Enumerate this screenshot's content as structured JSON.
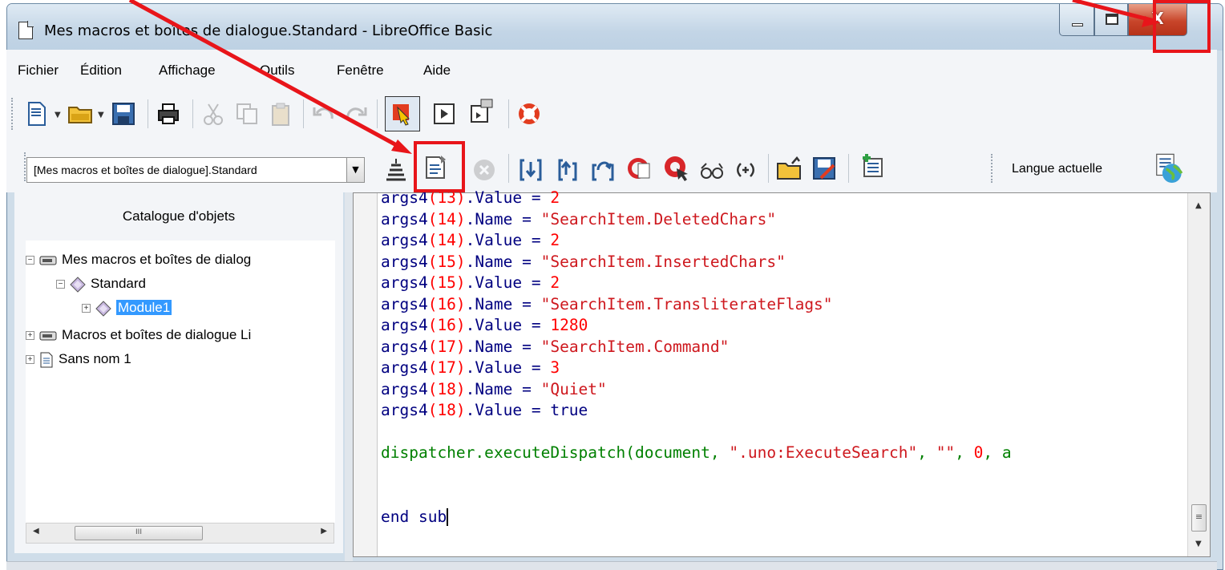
{
  "window": {
    "title": "Mes macros et boîtes de dialogue.Standard - LibreOffice Basic",
    "close_glyph": "X"
  },
  "menu": [
    "Fichier",
    "Édition",
    "Affichage",
    "Outils",
    "Fenêtre",
    "Aide"
  ],
  "toolbar1": {
    "icons": [
      "new-document-icon",
      "open-folder-icon",
      "save-icon",
      "print-icon",
      "cut-icon",
      "copy-icon",
      "paste-icon",
      "undo-icon",
      "redo-icon",
      "choose-macro-icon",
      "run-icon",
      "dialog-control-icon",
      "help-lifebuoy-icon"
    ]
  },
  "toolbar2": {
    "library_select": "[Mes macros et boîtes de dialogue].Standard",
    "language_label": "Langue actuelle",
    "icons": [
      "compile-icon",
      "run-basic-icon",
      "stop-icon",
      "step-into-icon",
      "step-out-icon",
      "step-over-icon",
      "breakpoint-icon",
      "manage-breakpoints-icon",
      "watch-glasses-icon",
      "find-parentheses-icon",
      "import-basic-icon",
      "export-basic-icon",
      "object-catalog-icon",
      "language-icon"
    ]
  },
  "catalog": {
    "title": "Catalogue d'objets",
    "tree": [
      {
        "label": "Mes macros et boîtes de dialog",
        "expander": "−",
        "level": 0,
        "icon": "drive-icon"
      },
      {
        "label": "Standard",
        "expander": "−",
        "level": 1,
        "icon": "library-diamond-icon"
      },
      {
        "label": "Module1",
        "expander": "+",
        "level": 2,
        "icon": "module-diamond-icon",
        "selected": true
      },
      {
        "label": "Macros et boîtes de dialogue Li",
        "expander": "+",
        "level": 0,
        "icon": "drive-icon"
      },
      {
        "label": "Sans nom 1",
        "expander": "+",
        "level": 0,
        "icon": "document-icon"
      }
    ],
    "hscroll_grip": "III"
  },
  "editor": {
    "lines": [
      [
        {
          "t": "args4",
          "c": "id"
        },
        {
          "t": "(13)",
          "c": "num"
        },
        {
          "t": ".Value = ",
          "c": "id"
        },
        {
          "t": "2",
          "c": "num"
        }
      ],
      [
        {
          "t": "args4",
          "c": "id"
        },
        {
          "t": "(14)",
          "c": "num"
        },
        {
          "t": ".Name = ",
          "c": "id"
        },
        {
          "t": "\"SearchItem.DeletedChars\"",
          "c": "str"
        }
      ],
      [
        {
          "t": "args4",
          "c": "id"
        },
        {
          "t": "(14)",
          "c": "num"
        },
        {
          "t": ".Value = ",
          "c": "id"
        },
        {
          "t": "2",
          "c": "num"
        }
      ],
      [
        {
          "t": "args4",
          "c": "id"
        },
        {
          "t": "(15)",
          "c": "num"
        },
        {
          "t": ".Name = ",
          "c": "id"
        },
        {
          "t": "\"SearchItem.InsertedChars\"",
          "c": "str"
        }
      ],
      [
        {
          "t": "args4",
          "c": "id"
        },
        {
          "t": "(15)",
          "c": "num"
        },
        {
          "t": ".Value = ",
          "c": "id"
        },
        {
          "t": "2",
          "c": "num"
        }
      ],
      [
        {
          "t": "args4",
          "c": "id"
        },
        {
          "t": "(16)",
          "c": "num"
        },
        {
          "t": ".Name = ",
          "c": "id"
        },
        {
          "t": "\"SearchItem.TransliterateFlags\"",
          "c": "str"
        }
      ],
      [
        {
          "t": "args4",
          "c": "id"
        },
        {
          "t": "(16)",
          "c": "num"
        },
        {
          "t": ".Value = ",
          "c": "id"
        },
        {
          "t": "1280",
          "c": "num"
        }
      ],
      [
        {
          "t": "args4",
          "c": "id"
        },
        {
          "t": "(17)",
          "c": "num"
        },
        {
          "t": ".Name = ",
          "c": "id"
        },
        {
          "t": "\"SearchItem.Command\"",
          "c": "str"
        }
      ],
      [
        {
          "t": "args4",
          "c": "id"
        },
        {
          "t": "(17)",
          "c": "num"
        },
        {
          "t": ".Value = ",
          "c": "id"
        },
        {
          "t": "3",
          "c": "num"
        }
      ],
      [
        {
          "t": "args4",
          "c": "id"
        },
        {
          "t": "(18)",
          "c": "num"
        },
        {
          "t": ".Name = ",
          "c": "id"
        },
        {
          "t": "\"Quiet\"",
          "c": "str"
        }
      ],
      [
        {
          "t": "args4",
          "c": "id"
        },
        {
          "t": "(18)",
          "c": "num"
        },
        {
          "t": ".Value = true",
          "c": "id"
        }
      ],
      [],
      [
        {
          "t": "dispatcher.executeDispatch(document, ",
          "c": "fn"
        },
        {
          "t": "\".uno:ExecuteSearch\"",
          "c": "str"
        },
        {
          "t": ", ",
          "c": "fn"
        },
        {
          "t": "\"\"",
          "c": "str"
        },
        {
          "t": ", ",
          "c": "fn"
        },
        {
          "t": "0",
          "c": "num"
        },
        {
          "t": ", a",
          "c": "fn"
        }
      ],
      [],
      [],
      [
        {
          "t": "end sub",
          "c": "kw"
        }
      ]
    ],
    "vscroll_grip": "≡"
  },
  "annotation": {
    "color": "#e8151a"
  }
}
